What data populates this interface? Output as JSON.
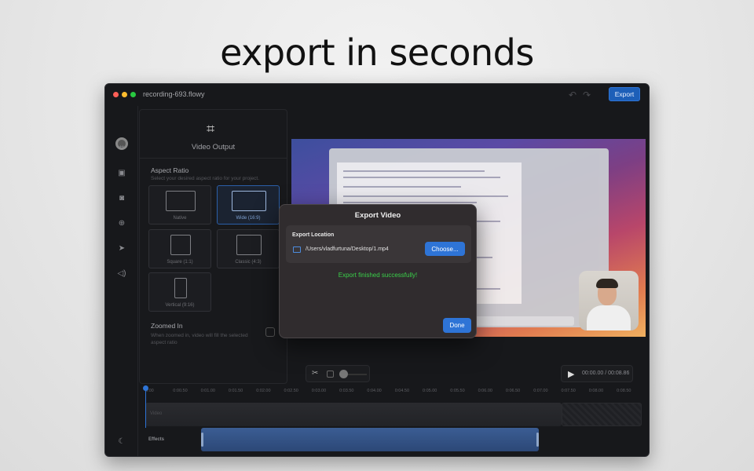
{
  "headline": "export in seconds",
  "window": {
    "title": "recording-693.flowy",
    "export_label": "Export"
  },
  "panel": {
    "title": "Video Output",
    "aspect_ratio_title": "Aspect Ratio",
    "aspect_ratio_sub": "Select your desired aspect ratio for your project.",
    "ratios": [
      {
        "label": "Native",
        "selected": false
      },
      {
        "label": "Wide (16:9)",
        "selected": true
      },
      {
        "label": "Square (1:1)",
        "selected": false
      },
      {
        "label": "Classic (4:3)",
        "selected": false
      },
      {
        "label": "Vertical (9:16)",
        "selected": false
      }
    ],
    "zoomed_title": "Zoomed In",
    "zoomed_sub": "When zoomed in, video will fill the selected aspect ratio"
  },
  "player": {
    "time": "00:00.00 / 00:08.86"
  },
  "timeline": {
    "ticks": [
      "0:00",
      "0:00.50",
      "0:01.00",
      "0:01.50",
      "0:02.00",
      "0:02.50",
      "0:03.00",
      "0:03.50",
      "0:04.00",
      "0:04.50",
      "0:05.00",
      "0:05.50",
      "0:06.00",
      "0:06.50",
      "0:07.00",
      "0:07.50",
      "0:08.00",
      "0:08.50"
    ],
    "video_label": "Video",
    "effects_label": "Effects"
  },
  "modal": {
    "title": "Export Video",
    "location_label": "Export Location",
    "path": "/Users/vladfurtuna/Desktop/1.mp4",
    "choose_label": "Choose...",
    "status": "Export finished successfully!",
    "done_label": "Done"
  },
  "colors": {
    "accent": "#2e74d6",
    "success": "#3ad04a"
  }
}
